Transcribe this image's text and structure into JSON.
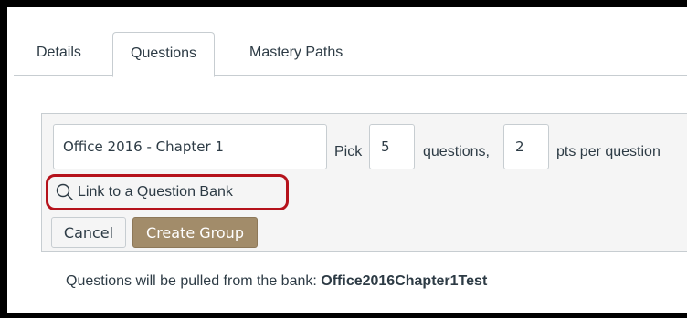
{
  "tabs": [
    {
      "label": "Details"
    },
    {
      "label": "Questions"
    },
    {
      "label": "Mastery Paths"
    }
  ],
  "active_tab": "Questions",
  "group": {
    "name_value": "Office 2016 - Chapter 1",
    "pick_label": "Pick",
    "pick_value": "5",
    "questions_label": "questions,",
    "pts_value": "2",
    "pts_label": "pts per question"
  },
  "bank_link": {
    "label": "Link to a Question Bank",
    "icon": "search-icon",
    "highlight_color": "#b5121b"
  },
  "buttons": {
    "cancel_label": "Cancel",
    "create_label": "Create Group",
    "create_color": "#a28c6a"
  },
  "notice": {
    "prefix": "Questions will be pulled from the bank: ",
    "bank_name": "Office2016Chapter1Test"
  }
}
